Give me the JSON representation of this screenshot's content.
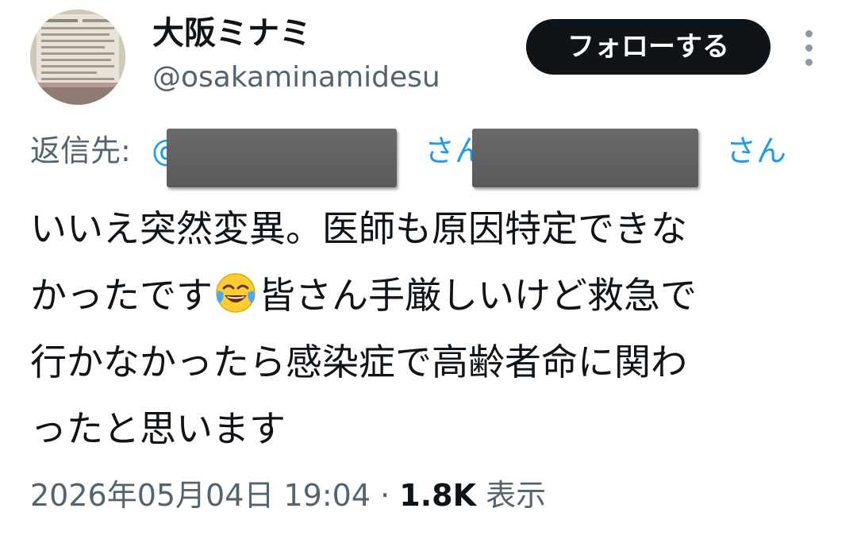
{
  "user": {
    "display_name": "大阪ミナミ",
    "handle": "@osakaminamidesu",
    "follow_label": "フォローする"
  },
  "reply": {
    "label": "返信先:",
    "mention_prefix": "@",
    "mention1_suffix": "さん、",
    "mention2_suffix": "さん"
  },
  "tweet": {
    "line1": "いいえ突然変異。医師も原因特定できな",
    "line2_before_emoji": "かったです",
    "emoji": "face-with-tears-of-joy",
    "line2_after_emoji": "皆さん手厳しいけど救急で",
    "line3": "行かなかったら感染症で高齢者命に関わ",
    "line4": "ったと思います"
  },
  "meta": {
    "timestamp": "2026年05月04日 19:04",
    "separator": " · ",
    "views_count": "1.8K",
    "views_label": " 表示"
  },
  "colors": {
    "text_primary": "#0f1419",
    "text_secondary": "#536471",
    "link": "#1d9bf0",
    "follow_bg": "#0f1419",
    "redaction": "#5f5f5f"
  }
}
